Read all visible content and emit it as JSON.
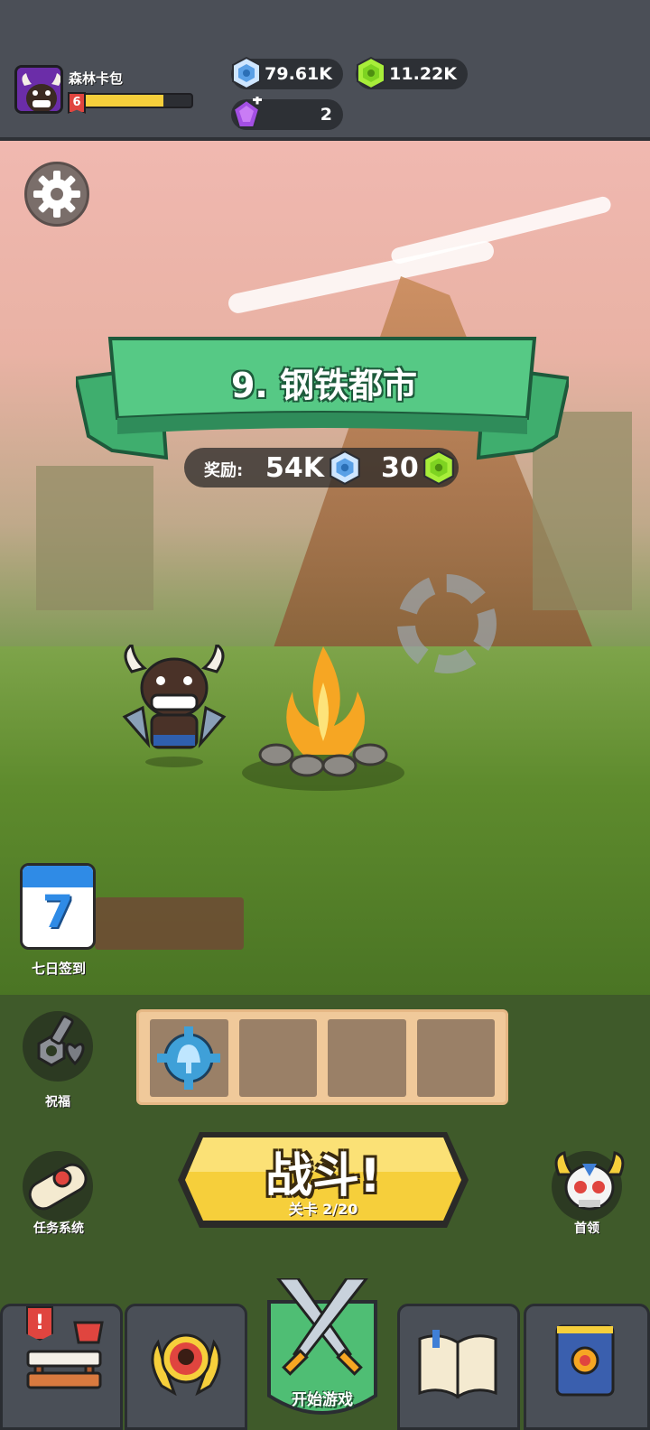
{
  "player": {
    "name": "森林卡包",
    "level": "6",
    "xp_fraction": 0.75
  },
  "currencies": {
    "blue_gems": "79.61K",
    "green_gems": "11.22K",
    "purple_gems": "2"
  },
  "stage": {
    "title": "9. 钢铁都市",
    "reward_label": "奖励:",
    "reward_blue": "54K",
    "reward_green": "30"
  },
  "side_buttons": {
    "daily_signin_day": "7",
    "daily_signin_label": "七日签到",
    "blessing_label": "祝福",
    "tasks_label": "任务系统",
    "boss_label": "首领"
  },
  "battle": {
    "title": "战斗!",
    "subtitle": "关卡 2/20"
  },
  "nav": {
    "active_label": "开始游戏",
    "shop_badge": "!"
  },
  "colors": {
    "banner_green": "#56c985",
    "battle_yellow": "#f6cf3b",
    "blue_gem": "#5aa0e6",
    "green_gem": "#7ed321",
    "purple_gem": "#a34fe3"
  },
  "icons": {
    "settings": "gear-icon",
    "blessing": "nuts-bolts-heart-icon",
    "tasks": "scroll-icon",
    "boss": "horned-skull-icon",
    "shop": "shop-stall-icon",
    "rank": "skull-badge-icon",
    "play": "crossed-swords-icon",
    "codex": "open-book-icon",
    "skills": "gear-book-icon"
  }
}
